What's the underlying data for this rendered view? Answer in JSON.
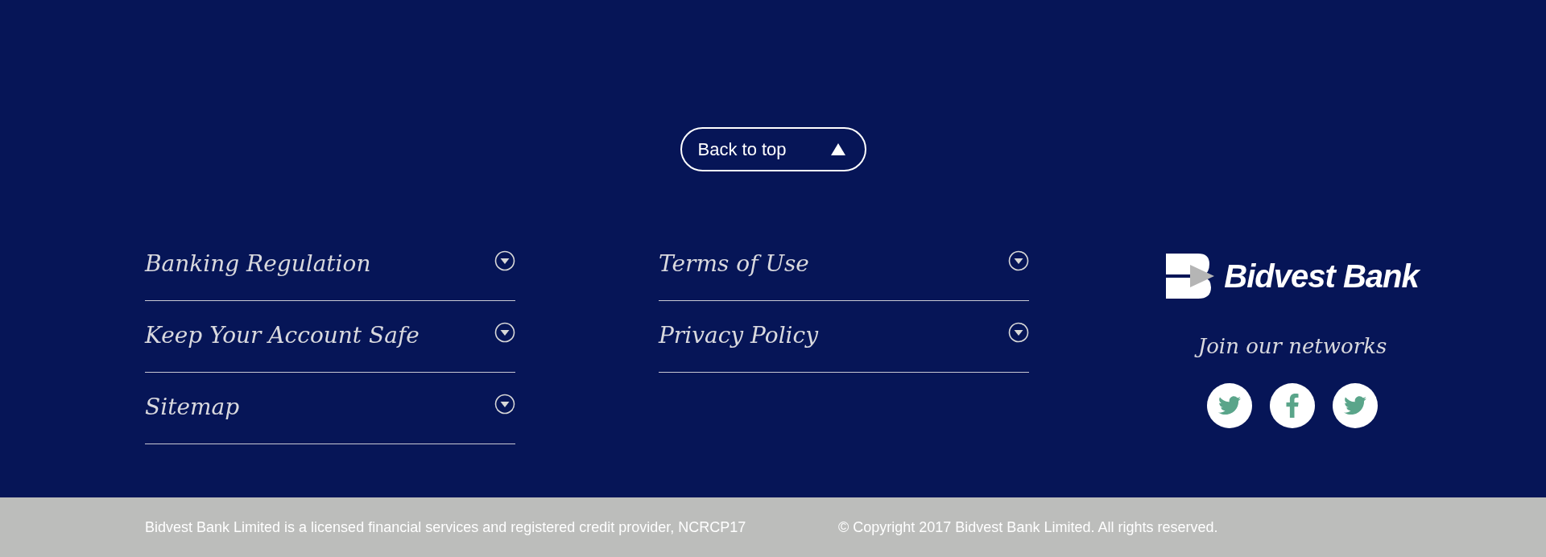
{
  "back_to_top": {
    "label": "Back to top"
  },
  "link_columns": [
    {
      "items": [
        {
          "label": "Banking Regulation",
          "expanded": false
        },
        {
          "label": "Keep Your Account Safe",
          "expanded": false
        },
        {
          "label": "Sitemap",
          "expanded": false
        }
      ]
    },
    {
      "items": [
        {
          "label": "Terms of Use",
          "expanded": false
        },
        {
          "label": "Privacy Policy",
          "expanded": false
        }
      ]
    }
  ],
  "brand": {
    "logo_text": "Bidvest Bank",
    "networks_heading": "Join our networks",
    "social": [
      {
        "kind": "twitter"
      },
      {
        "kind": "facebook"
      },
      {
        "kind": "twitter"
      }
    ]
  },
  "footer": {
    "licence": "Bidvest Bank Limited is a licensed financial services and registered credit provider, NCRCP17",
    "copyright": "© Copyright 2017 Bidvest Bank Limited. All rights reserved."
  }
}
